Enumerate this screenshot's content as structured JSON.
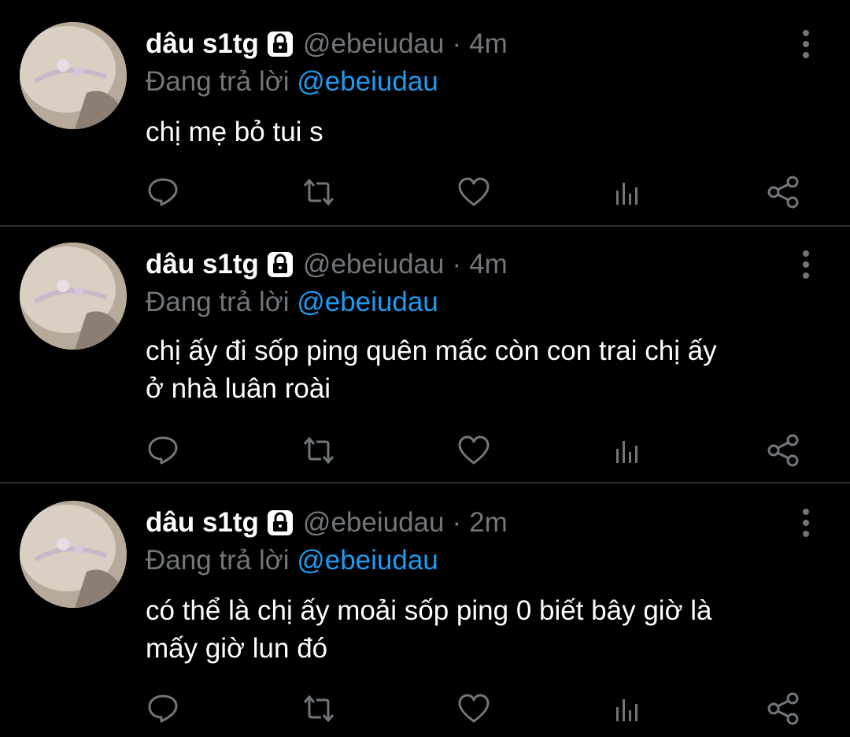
{
  "colors": {
    "background": "#000000",
    "name": "#ffffff",
    "secondary": "#71767b",
    "mention": "#1d9bf0",
    "divider": "#2f3336"
  },
  "icons": {
    "protected": "lock-icon",
    "more": "more-vertical-icon",
    "reply": "reply-icon",
    "retweet": "retweet-icon",
    "like": "heart-icon",
    "analytics": "analytics-icon",
    "share": "share-icon"
  },
  "tweets": [
    {
      "name": "dâu s1tg",
      "handle": "@ebeiudau",
      "separator": "·",
      "time": "4m",
      "replying_prefix": "Đang trả lời",
      "replying_to": "@ebeiudau",
      "lines": [
        "chị mẹ bỏ tui s"
      ]
    },
    {
      "name": "dâu s1tg",
      "handle": "@ebeiudau",
      "separator": "·",
      "time": "4m",
      "replying_prefix": "Đang trả lời",
      "replying_to": "@ebeiudau",
      "lines": [
        "chị ấy đi sốp ping quên mấc còn con trai chị ấy",
        "ở nhà luân roài"
      ]
    },
    {
      "name": "dâu s1tg",
      "handle": "@ebeiudau",
      "separator": "·",
      "time": "2m",
      "replying_prefix": "Đang trả lời",
      "replying_to": "@ebeiudau",
      "lines": [
        "có thể là chị ấy moải sốp ping 0 biết bây giờ là",
        "mấy giờ lun đó"
      ]
    }
  ]
}
